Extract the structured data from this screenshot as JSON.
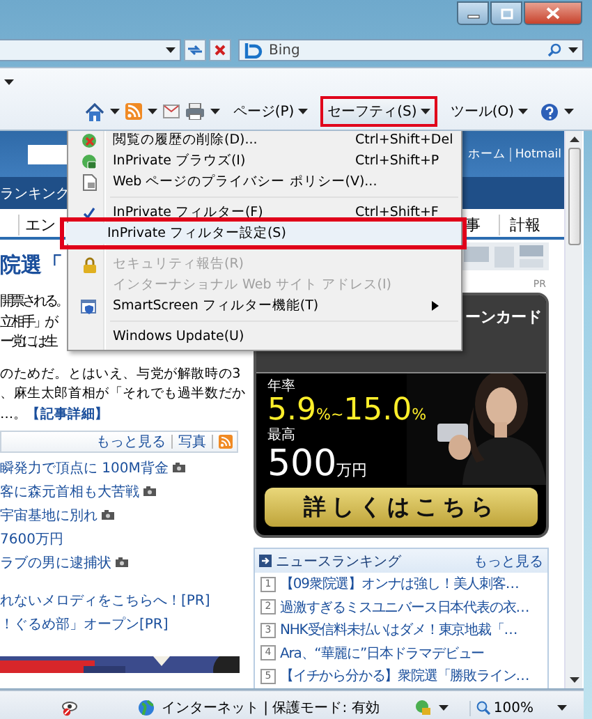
{
  "browser": {
    "search_placeholder": "Bing"
  },
  "command_bar": {
    "menus": [
      {
        "label": "ページ(P)",
        "selected": false
      },
      {
        "label": "セーフティ(S)",
        "selected": true
      },
      {
        "label": "ツール(O)",
        "selected": false
      }
    ]
  },
  "safety_menu": {
    "groups": [
      [
        {
          "kind": "history",
          "label": "閲覧の履歴の削除(D)...",
          "shortcut": "Ctrl+Shift+Del",
          "checked": false,
          "disabled": false,
          "selected": false,
          "submenu": false
        },
        {
          "kind": "inprivate",
          "label": "InPrivate ブラウズ(I)",
          "shortcut": "Ctrl+Shift+P",
          "checked": false,
          "disabled": false,
          "selected": false,
          "submenu": false
        },
        {
          "kind": "privacy",
          "label": "Web ページのプライバシー ポリシー(V)...",
          "checked": false,
          "disabled": false,
          "selected": false,
          "submenu": false
        }
      ],
      [
        {
          "kind": "plain",
          "label": "InPrivate フィルター(F)",
          "shortcut": "Ctrl+Shift+F",
          "checked": true,
          "disabled": false,
          "selected": false,
          "submenu": false
        },
        {
          "kind": "plain",
          "label": "InPrivate フィルター設定(S)",
          "checked": false,
          "disabled": false,
          "selected": true,
          "submenu": false
        }
      ],
      [
        {
          "kind": "security",
          "label": "セキュリティ報告(R)",
          "checked": false,
          "disabled": true,
          "selected": false,
          "submenu": false
        },
        {
          "kind": "plain",
          "label": "インターナショナル Web サイト アドレス(I)",
          "checked": false,
          "disabled": true,
          "selected": false,
          "submenu": false
        },
        {
          "kind": "smartscreen",
          "label": "SmartScreen フィルター機能(T)",
          "checked": false,
          "disabled": false,
          "selected": false,
          "submenu": true
        }
      ],
      [
        {
          "kind": "plain",
          "label": "Windows Update(U)",
          "checked": false,
          "disabled": false,
          "selected": false,
          "submenu": false
        }
      ]
    ]
  },
  "web_page": {
    "header_links": [
      "ホーム",
      "Hotmail"
    ],
    "nav_items": [
      "ランキング"
    ],
    "category_tabs": [
      "エン",
      "事",
      "計報"
    ],
    "headline": "院選「",
    "lead_lines": [
      "開票される。",
      "立相手」が",
      "ー党には生"
    ],
    "body_lines": [
      "のためだ。とはいえ、与党が解散時の3",
      "、麻生太郎首相が「それでも過半数だか"
    ],
    "tail": "…。",
    "detail_link": "【記事詳細】",
    "photo_bar_links": [
      "もっと見る",
      "写真"
    ],
    "news": [
      {
        "text": "瞬発力で頂点に 100M背金",
        "photo": true
      },
      {
        "text": "客に森元首相も大苦戦",
        "photo": true
      },
      {
        "text": "宇宙基地に別れ",
        "photo": true
      },
      {
        "text": "7600万円",
        "photo": false
      },
      {
        "text": "ラブの男に逮捕状",
        "photo": true
      }
    ],
    "pr_links": [
      "れないメロディをこちらへ！[PR]",
      "！ぐるめ部」オープン[PR]"
    ],
    "ad": {
      "pr": "PR",
      "title": "ーンカード",
      "rate_label": "年率",
      "rate": [
        {
          "text": "5.9",
          "kind": "number"
        },
        {
          "text": "%~",
          "kind": "unit"
        },
        {
          "text": "15.0",
          "kind": "number"
        },
        {
          "text": "%",
          "kind": "unit"
        }
      ],
      "limit_label": "最高",
      "limit": [
        {
          "text": "500",
          "kind": "number"
        },
        {
          "text": "万円",
          "kind": "unit"
        }
      ],
      "button": "詳しくはこちら"
    },
    "ranking": {
      "title": "ニュースランキング",
      "more": "もっと見る",
      "items": [
        {
          "rank": "1",
          "text": "【09衆院選】オンナは強し！美人刺客…"
        },
        {
          "rank": "2",
          "text": "過激すぎるミスユニバース日本代表の衣…"
        },
        {
          "rank": "3",
          "text": "NHK受信料未払いはダメ！東京地裁「…"
        },
        {
          "rank": "4",
          "text": "Ara、“華麗に”日本ドラマデビュー"
        },
        {
          "rank": "5",
          "text": "【イチから分かる】衆院選「勝敗ライン…"
        }
      ]
    }
  },
  "status_bar": {
    "zone": "インターネット | 保護モード: 有効",
    "zoom": "100%"
  }
}
